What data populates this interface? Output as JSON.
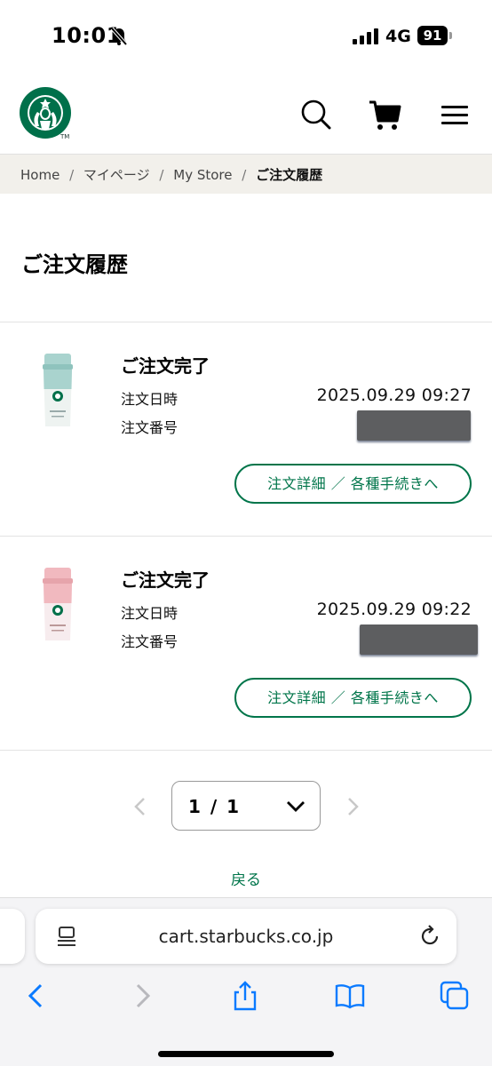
{
  "status_bar": {
    "time": "10:01",
    "network": "4G",
    "battery": "91"
  },
  "header": {
    "logo_mark": "TM"
  },
  "breadcrumb": {
    "items": [
      "Home",
      "マイページ",
      "My Store"
    ],
    "separator": "/",
    "current": "ご注文履歴"
  },
  "page": {
    "title": "ご注文履歴"
  },
  "orders": [
    {
      "status": "ご注文完了",
      "date_label": "注文日時",
      "date": "2025.09.29 09:27",
      "number_label": "注文番号",
      "button": "注文詳細 ／ 各種手続きへ",
      "tumbler_color": "#a9d3ce"
    },
    {
      "status": "ご注文完了",
      "date_label": "注文日時",
      "date": "2025.09.29 09:22",
      "number_label": "注文番号",
      "button": "注文詳細 ／ 各種手続きへ",
      "tumbler_color": "#f1b9bf"
    }
  ],
  "pagination": {
    "value": "1 / 1"
  },
  "back_label": "戻る",
  "browser": {
    "url": "cart.starbucks.co.jp"
  },
  "colors": {
    "accent": "#00754a",
    "brand": "#00704a",
    "breadcrumb_bg": "#f2f0eb",
    "ios_blue": "#0a7aff"
  }
}
